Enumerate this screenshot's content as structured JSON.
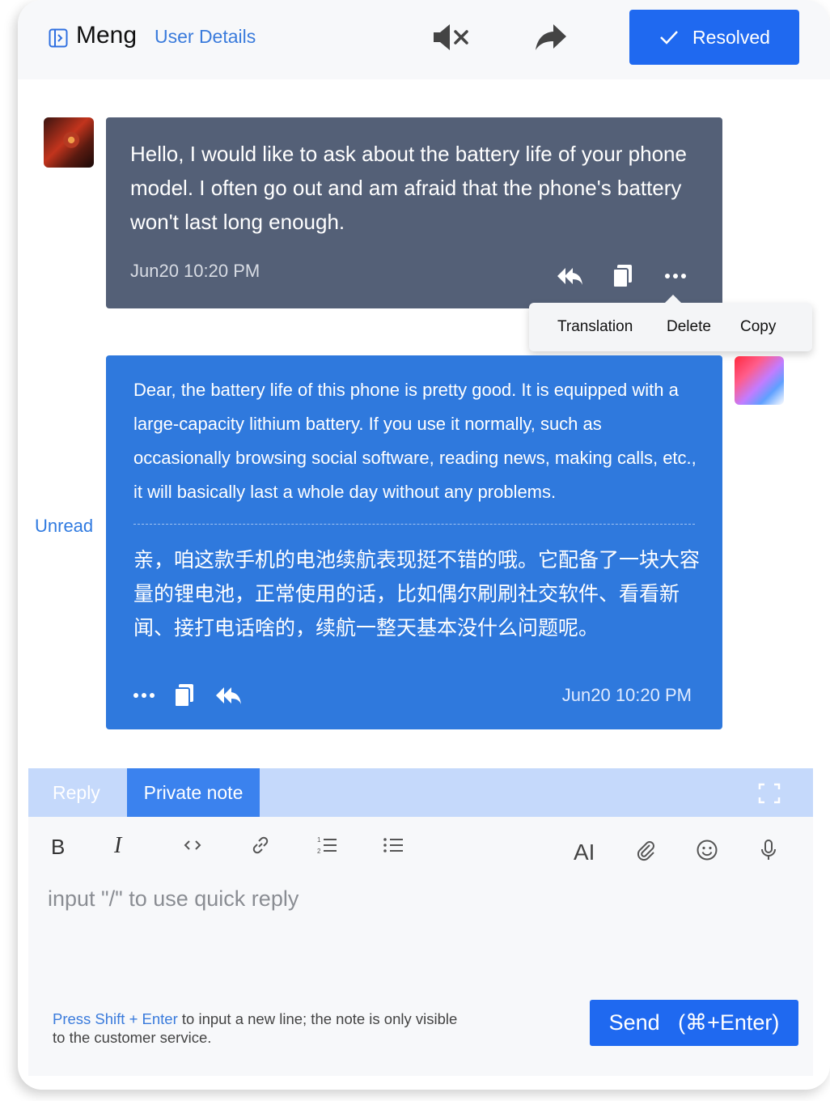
{
  "header": {
    "user_name": "Meng",
    "user_details_link": "User Details",
    "resolved_label": "Resolved"
  },
  "messages": [
    {
      "sender": "customer",
      "text": "Hello, I would like to ask about the battery life of your phone model. I often go out and am afraid that the phone's battery won't last long enough.",
      "time": "Jun20 10:20 PM"
    },
    {
      "sender": "agent",
      "status": "Unread",
      "text": "Dear, the battery life of this phone is pretty good. It is equipped with a large-capacity lithium battery. If you use it normally, such as occasionally browsing social software, reading news, making calls, etc., it will basically last a whole day without any problems.",
      "translation": "亲，咱这款手机的电池续航表现挺不错的哦。它配备了一块大容量的锂电池，正常使用的话，比如偶尔刷刷社交软件、看看新闻、接打电话啥的，续航一整天基本没什么问题呢。",
      "time": "Jun20 10:20 PM"
    }
  ],
  "context_menu": {
    "items": [
      "Translation",
      "Delete",
      "Copy"
    ]
  },
  "composer": {
    "tabs": [
      "Reply",
      "Private note"
    ],
    "active_tab": "Private note",
    "toolbar": {
      "bold_label": "B",
      "italic_label": "I",
      "ai_label": "AI"
    },
    "placeholder": "input \"/\" to use quick reply",
    "hint_highlight": "Press Shift + Enter",
    "hint_rest": " to input a new line; the note is only visible to the customer service.",
    "send_label": "Send   (⌘+Enter)"
  },
  "colors": {
    "accent": "#1f69f0",
    "customer_bubble": "#546077",
    "agent_bubble": "#2f79dd",
    "link": "#3a7bdc"
  }
}
